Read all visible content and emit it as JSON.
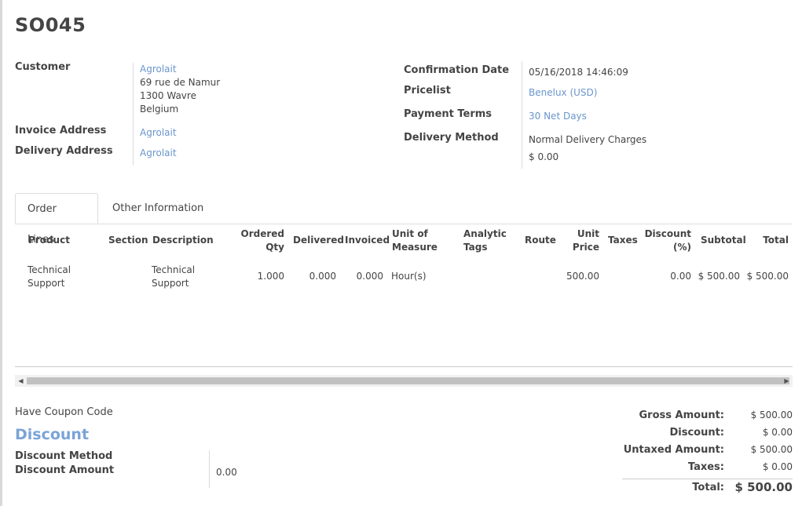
{
  "order": {
    "name": "SO045"
  },
  "customer": {
    "label": "Customer",
    "name": "Agrolait",
    "street": "69 rue de Namur",
    "city": "1300 Wavre",
    "country": "Belgium"
  },
  "invoice_address": {
    "label": "Invoice Address",
    "value": "Agrolait"
  },
  "delivery_address": {
    "label": "Delivery Address",
    "value": "Agrolait"
  },
  "confirmation_date": {
    "label": "Confirmation Date",
    "value": "05/16/2018 14:46:09"
  },
  "pricelist": {
    "label": "Pricelist",
    "value": "Benelux (USD)"
  },
  "payment_terms": {
    "label": "Payment Terms",
    "value": "30 Net Days"
  },
  "delivery_method": {
    "label": "Delivery Method",
    "value": "Normal Delivery Charges",
    "amount": "$ 0.00"
  },
  "tabs": [
    {
      "label": "Order Lines",
      "active": true
    },
    {
      "label": "Other Information",
      "active": false
    }
  ],
  "table": {
    "headers": {
      "product": "Product",
      "section": "Section",
      "description": "Description",
      "ordered_qty_1": "Ordered",
      "ordered_qty_2": "Qty",
      "delivered": "Delivered",
      "invoiced": "Invoiced",
      "uom_1": "Unit of",
      "uom_2": "Measure",
      "analytic_1": "Analytic",
      "analytic_2": "Tags",
      "route": "Route",
      "price_1": "Unit",
      "price_2": "Price",
      "taxes": "Taxes",
      "discount_1": "Discount",
      "discount_2": "(%)",
      "subtotal": "Subtotal",
      "total": "Total"
    },
    "rows": [
      {
        "product_1": "Technical",
        "product_2": "Support",
        "description_1": "Technical",
        "description_2": "Support",
        "ordered_qty": "1.000",
        "delivered": "0.000",
        "invoiced": "0.000",
        "uom": "Hour(s)",
        "price_unit": "500.00",
        "discount": "0.00",
        "subtotal": "$ 500.00",
        "total": "$ 500.00"
      }
    ]
  },
  "coupon": {
    "label": "Have Coupon Code"
  },
  "discount": {
    "heading": "Discount",
    "method_label": "Discount Method",
    "amount_label": "Discount Amount",
    "amount_value": "0.00"
  },
  "totals": {
    "gross_label": "Gross Amount:",
    "gross_value": "$ 500.00",
    "discount_label": "Discount:",
    "discount_value": "$ 0.00",
    "untaxed_label": "Untaxed Amount:",
    "untaxed_value": "$ 500.00",
    "taxes_label": "Taxes:",
    "taxes_value": "$ 0.00",
    "total_label": "Total:",
    "total_value": "$ 500.00"
  },
  "colors": {
    "link": "#6a96cc",
    "heading_accent": "#7aa3d8"
  }
}
